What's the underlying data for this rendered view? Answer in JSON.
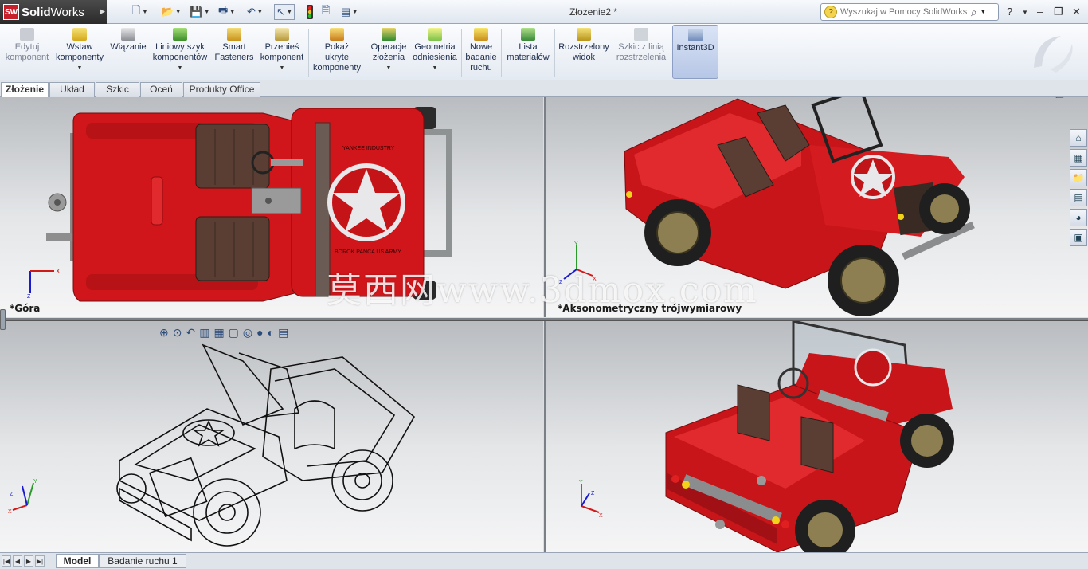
{
  "app": {
    "brand_solid": "Solid",
    "brand_works": "Works",
    "logo_letters": "SW"
  },
  "document": {
    "title": "Złożenie2 *"
  },
  "search": {
    "placeholder": "Wyszukaj w Pomocy SolidWorks"
  },
  "ribbon": {
    "buttons": [
      {
        "label": "Edytuj\nkomponent",
        "icon": "edit-component-icon",
        "disabled": true
      },
      {
        "label": "Wstaw\nkomponenty",
        "icon": "insert-components-icon"
      },
      {
        "label": "Wiązanie",
        "icon": "mate-icon"
      },
      {
        "label": "Liniowy szyk\nkomponentów",
        "icon": "linear-pattern-icon"
      },
      {
        "label": "Smart\nFasteners",
        "icon": "smart-fasteners-icon"
      },
      {
        "label": "Przenieś\nkomponent",
        "icon": "move-component-icon"
      },
      {
        "label": "Pokaż\nukryte\nkomponenty",
        "icon": "show-hidden-icon"
      },
      {
        "label": "Operacje\nzłożenia",
        "icon": "assembly-features-icon"
      },
      {
        "label": "Geometria\nodniesienia",
        "icon": "reference-geometry-icon"
      },
      {
        "label": "Nowe\nbadanie\nruchu",
        "icon": "new-motion-study-icon"
      },
      {
        "label": "Lista\nmateriałów",
        "icon": "bill-of-materials-icon"
      },
      {
        "label": "Rozstrzelony\nwidok",
        "icon": "exploded-view-icon"
      },
      {
        "label": "Szkic z linią\nrozstrzelenia",
        "icon": "explode-line-sketch-icon",
        "disabled": true
      },
      {
        "label": "Instant3D",
        "icon": "instant3d-icon",
        "active": true
      }
    ]
  },
  "tabs": [
    "Złożenie",
    "Układ",
    "Szkic",
    "Oceń",
    "Produkty Office"
  ],
  "viewports": {
    "top_left": "*Góra",
    "top_right": "*Aksonometryczny trójwymiarowy"
  },
  "watermark": "莫西网www.3dmox.com",
  "bottom_tabs": [
    "Model",
    "Badanie ruchu 1"
  ],
  "colors": {
    "jeep_red": "#d4171b",
    "seat_brown": "#5a3e33",
    "accent": "#2a4a7a"
  }
}
